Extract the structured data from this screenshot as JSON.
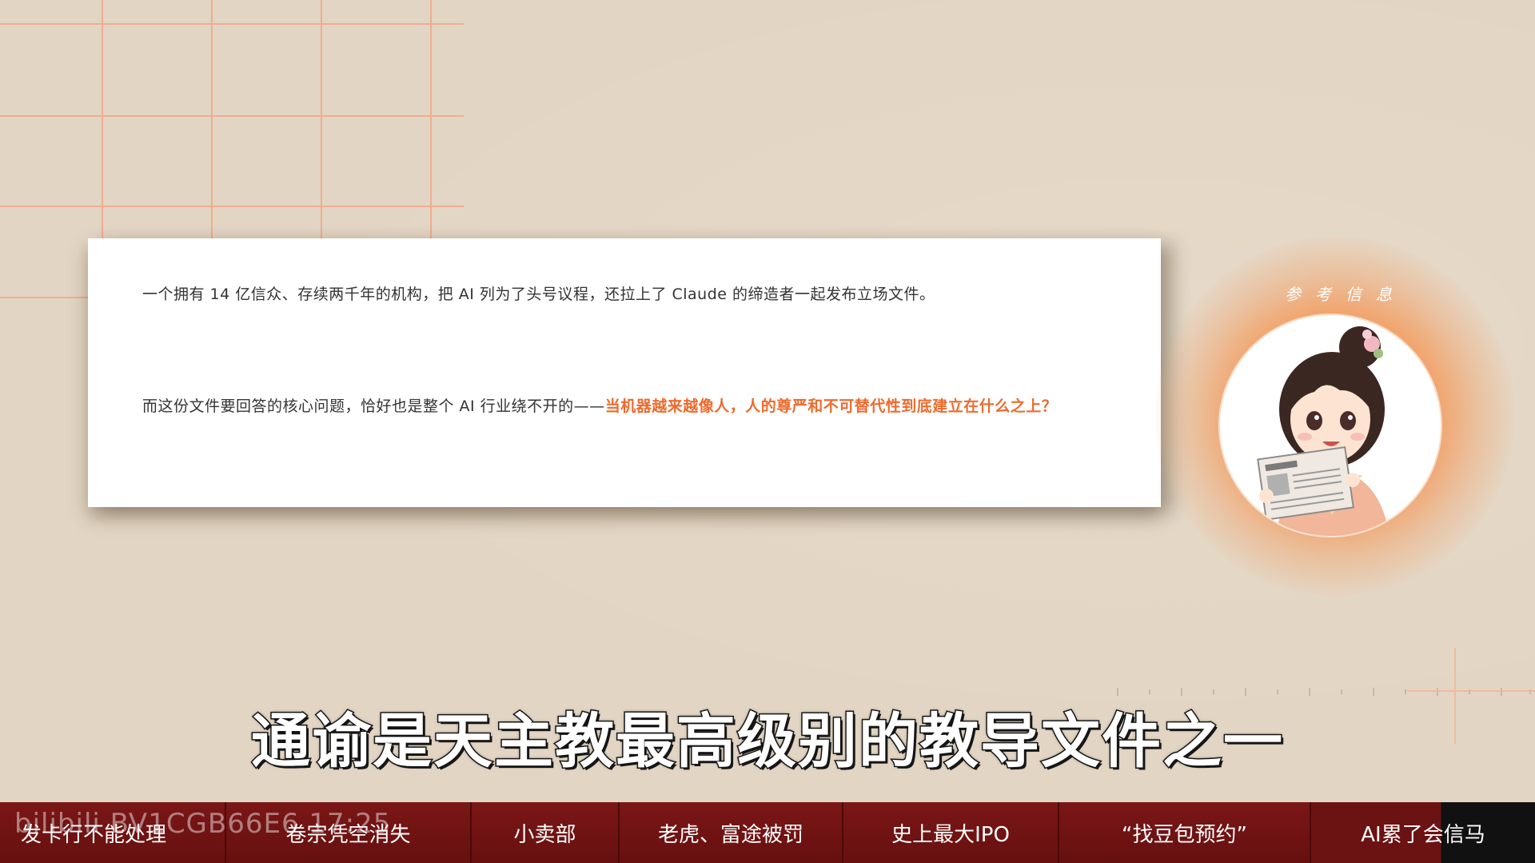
{
  "card": {
    "paragraph1": "一个拥有 14 亿信众、存续两千年的机构，把 AI 列为了头号议程，还拉上了 Claude 的缔造者一起发布立场文件。",
    "paragraph2_lead": "而这份文件要回答的核心问题，恰好也是整个 AI 行业绕不开的——",
    "paragraph2_highlight": "当机器越来越像人，人的尊严和不可替代性到底建立在什么之上？"
  },
  "avatar": {
    "caption": "参考信息",
    "icon": "newspaper-reading-girl-avatar"
  },
  "subtitle": "通谕是天主教最高级别的教导文件之一",
  "watermark": "bilibili BV1CGB66E6 17:25",
  "chapters": [
    "发卡行不能处理",
    "卷宗凭空消失",
    "小卖部",
    "老虎、富途被罚",
    "史上最大IPO",
    "“找豆包预约”",
    "AI累了会信马"
  ],
  "colors": {
    "background": "#e3d5c3",
    "grid_line": "#f0a080",
    "highlight": "#ee6a2c",
    "chapter_bar": "#6b1212",
    "avatar_glow": "#f58c46"
  }
}
